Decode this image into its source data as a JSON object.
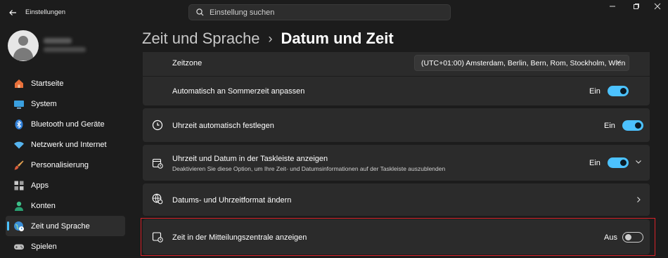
{
  "window": {
    "title": "Einstellungen"
  },
  "search": {
    "placeholder": "Einstellung suchen"
  },
  "profile": {
    "name": "",
    "email": ""
  },
  "sidebar": {
    "items": [
      {
        "label": "Startseite",
        "icon": "home-icon"
      },
      {
        "label": "System",
        "icon": "monitor-icon"
      },
      {
        "label": "Bluetooth und Geräte",
        "icon": "bluetooth-icon"
      },
      {
        "label": "Netzwerk und Internet",
        "icon": "wifi-icon"
      },
      {
        "label": "Personalisierung",
        "icon": "brush-icon"
      },
      {
        "label": "Apps",
        "icon": "apps-icon"
      },
      {
        "label": "Konten",
        "icon": "person-icon"
      },
      {
        "label": "Zeit und Sprache",
        "icon": "globe-clock-icon",
        "active": true
      },
      {
        "label": "Spielen",
        "icon": "gamepad-icon"
      }
    ]
  },
  "header": {
    "parent": "Zeit und Sprache",
    "separator": "›",
    "current": "Datum und Zeit"
  },
  "settings": {
    "timezone": {
      "label": "Zeitzone",
      "value": "(UTC+01:00) Amsterdam, Berlin, Bern, Rom, Stockholm, Wien"
    },
    "dst": {
      "label": "Automatisch an Sommerzeit anpassen",
      "state": "Ein",
      "on": true
    },
    "auto_time": {
      "label": "Uhrzeit automatisch festlegen",
      "state": "Ein",
      "on": true
    },
    "taskbar": {
      "label": "Uhrzeit und Datum in der Taskleiste anzeigen",
      "description": "Deaktivieren Sie diese Option, um Ihre Zeit- und Datumsinformationen auf der Taskleiste auszublenden",
      "state": "Ein",
      "on": true
    },
    "format": {
      "label": "Datums- und Uhrzeitformat ändern"
    },
    "notification_center": {
      "label": "Zeit in der Mitteilungszentrale anzeigen",
      "state": "Aus",
      "on": false
    }
  },
  "colors": {
    "accent": "#4cc2ff",
    "highlight": "#d9232a",
    "background": "#1c1c1c",
    "card": "#2b2b2b"
  }
}
